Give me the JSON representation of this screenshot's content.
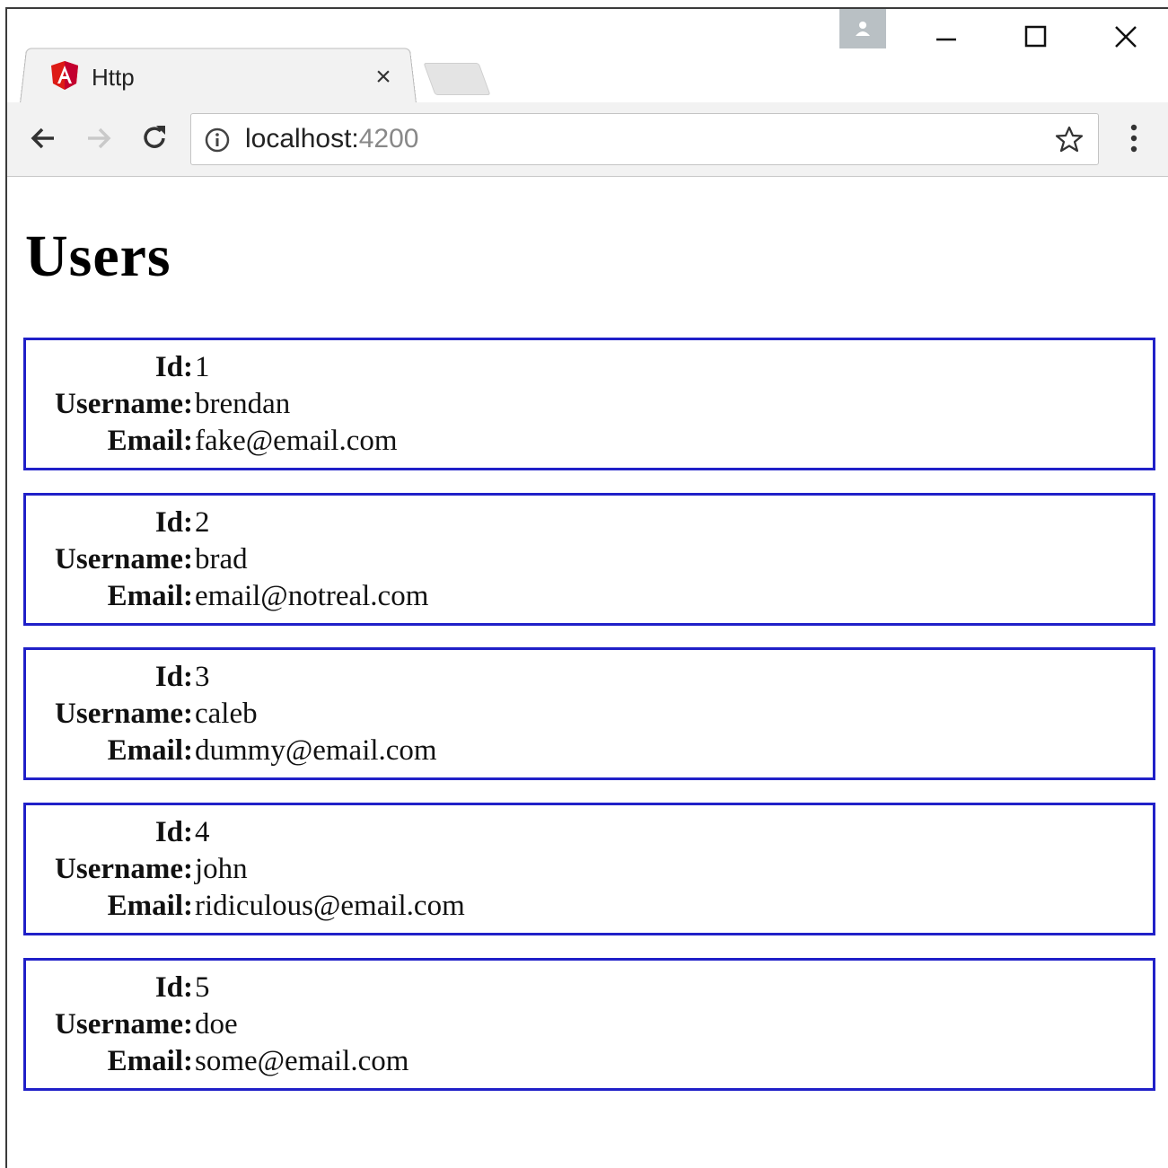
{
  "browser": {
    "tab_title": "Http",
    "tab_close": "×",
    "url_host": "localhost:",
    "url_port": "4200"
  },
  "page": {
    "title": "Users",
    "labels": {
      "id": "Id:",
      "username": "Username:",
      "email": "Email:"
    }
  },
  "users": [
    {
      "id": "1",
      "username": "brendan",
      "email": "fake@email.com"
    },
    {
      "id": "2",
      "username": "brad",
      "email": "email@notreal.com"
    },
    {
      "id": "3",
      "username": "caleb",
      "email": "dummy@email.com"
    },
    {
      "id": "4",
      "username": "john",
      "email": "ridiculous@email.com"
    },
    {
      "id": "5",
      "username": "doe",
      "email": "some@email.com"
    }
  ],
  "colors": {
    "card_border": "#2020c8",
    "angular_red": "#dd1b16"
  },
  "icons": [
    "angular-logo-icon",
    "close-icon",
    "profile-icon",
    "minimize-icon",
    "maximize-icon",
    "window-close-icon",
    "back-icon",
    "forward-icon",
    "reload-icon",
    "info-icon",
    "star-icon",
    "menu-icon"
  ]
}
